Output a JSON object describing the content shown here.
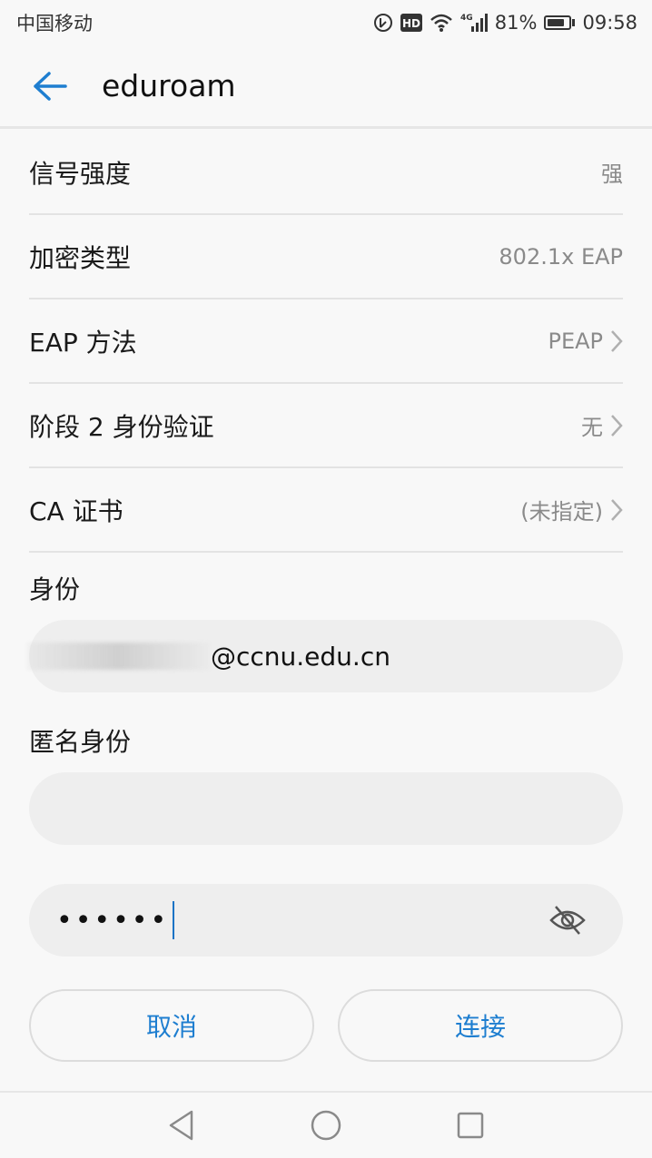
{
  "status_bar": {
    "carrier": "中国移动",
    "hd_badge": "HD",
    "network": "4G",
    "battery": "81%",
    "battery_level": 0.81,
    "time": "09:58"
  },
  "header": {
    "title": "eduroam"
  },
  "settings": [
    {
      "label": "信号强度",
      "value": "强",
      "chevron": false
    },
    {
      "label": "加密类型",
      "value": "802.1x EAP",
      "chevron": false
    },
    {
      "label": "EAP 方法",
      "value": "PEAP",
      "chevron": true
    },
    {
      "label": "阶段 2 身份验证",
      "value": "无",
      "chevron": true
    },
    {
      "label": "CA 证书",
      "value": "(未指定)",
      "chevron": true
    }
  ],
  "identity": {
    "label": "身份",
    "value_visible": "@ccnu.edu.cn"
  },
  "anonymous_identity": {
    "label": "匿名身份",
    "value": ""
  },
  "password": {
    "masked_value": "••••••"
  },
  "buttons": {
    "cancel": "取消",
    "connect": "连接"
  },
  "colors": {
    "accent": "#1e7ed0",
    "background": "#f8f8f8",
    "input_bg": "#eeeeee"
  },
  "icons": {
    "back": "arrow-left-icon",
    "chevron": "chevron-right-icon",
    "visibility": "eye-off-icon",
    "nav_back": "triangle-back-icon",
    "nav_home": "circle-home-icon",
    "nav_recents": "square-recents-icon"
  }
}
